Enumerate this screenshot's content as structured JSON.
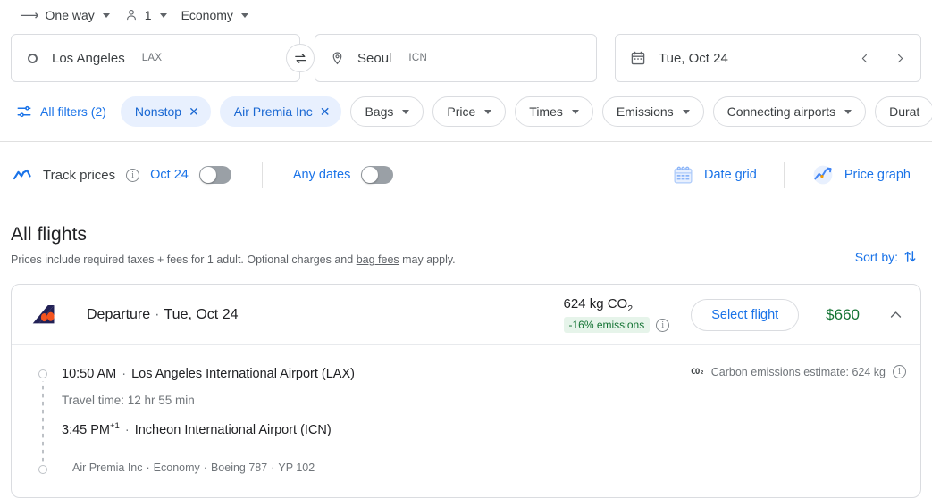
{
  "trip_options": {
    "trip_type": "One way",
    "passengers": "1",
    "cabin_class": "Economy",
    "arrow_icon": "arrow-right-icon",
    "person_icon": "person-icon"
  },
  "search": {
    "origin": {
      "city": "Los Angeles",
      "code": "LAX",
      "icon": "circle-outline-icon"
    },
    "destination": {
      "city": "Seoul",
      "code": "ICN",
      "icon": "map-pin-icon"
    },
    "swap_icon": "swap-arrows-icon",
    "date": {
      "value": "Tue, Oct 24",
      "icon": "calendar-icon"
    },
    "prev_date_icon": "chevron-left-icon",
    "next_date_icon": "chevron-right-icon"
  },
  "filters": {
    "all_filters_label": "All filters (2)",
    "all_filters_icon": "tune-filter-icon",
    "chips": [
      {
        "label": "Nonstop",
        "active": true,
        "close_icon": "close-icon"
      },
      {
        "label": "Air Premia Inc",
        "active": true,
        "close_icon": "close-icon"
      },
      {
        "label": "Bags",
        "active": false
      },
      {
        "label": "Price",
        "active": false
      },
      {
        "label": "Times",
        "active": false
      },
      {
        "label": "Emissions",
        "active": false
      },
      {
        "label": "Connecting airports",
        "active": false
      },
      {
        "label": "Durat",
        "active": false
      }
    ]
  },
  "track": {
    "icon": "trending-line-icon",
    "label": "Track prices",
    "info_icon": "info-icon",
    "date_link": "Oct 24",
    "date_toggle_state": "off",
    "any_dates_link": "Any dates",
    "any_dates_toggle_state": "off",
    "date_grid_label": "Date grid",
    "date_grid_icon": "date-grid-icon",
    "price_graph_label": "Price graph",
    "price_graph_icon": "price-graph-icon"
  },
  "results": {
    "title": "All flights",
    "subtitle_pre": "Prices include required taxes + fees for 1 adult. Optional charges and ",
    "subtitle_link": "bag fees",
    "subtitle_post": " may apply.",
    "sort_by_label": "Sort by:",
    "sort_icon": "sort-arrows-icon"
  },
  "flight": {
    "airline_logo": "air-premia-tail-logo",
    "header_label": "Departure",
    "header_date": "Tue, Oct 24",
    "co2_amount": "624 kg CO",
    "co2_subscript": "2",
    "emissions_badge": "-16% emissions",
    "emissions_info_icon": "info-icon",
    "select_button": "Select flight",
    "price": "$660",
    "collapse_icon": "chevron-up-icon",
    "depart_time": "10:50 AM",
    "depart_airport": "Los Angeles International Airport (LAX)",
    "travel_time": "Travel time: 12 hr 55 min",
    "arrive_time": "3:45 PM",
    "arrive_day_offset": "+1",
    "arrive_airport": "Incheon International Airport (ICN)",
    "carbon_estimate_icon": "co2-icon",
    "carbon_estimate": "Carbon emissions estimate: 624 kg",
    "carbon_info_icon": "info-icon",
    "detail_airline": "Air Premia Inc",
    "detail_cabin": "Economy",
    "detail_aircraft": "Boeing 787",
    "detail_flight_no": "YP 102"
  },
  "colors": {
    "accent_blue": "#1a73e8",
    "chip_active_bg": "#e8f0fe",
    "price_green": "#137333",
    "badge_bg": "#e6f4ea",
    "logo_navy": "#222156",
    "logo_orange": "#f4541f"
  }
}
